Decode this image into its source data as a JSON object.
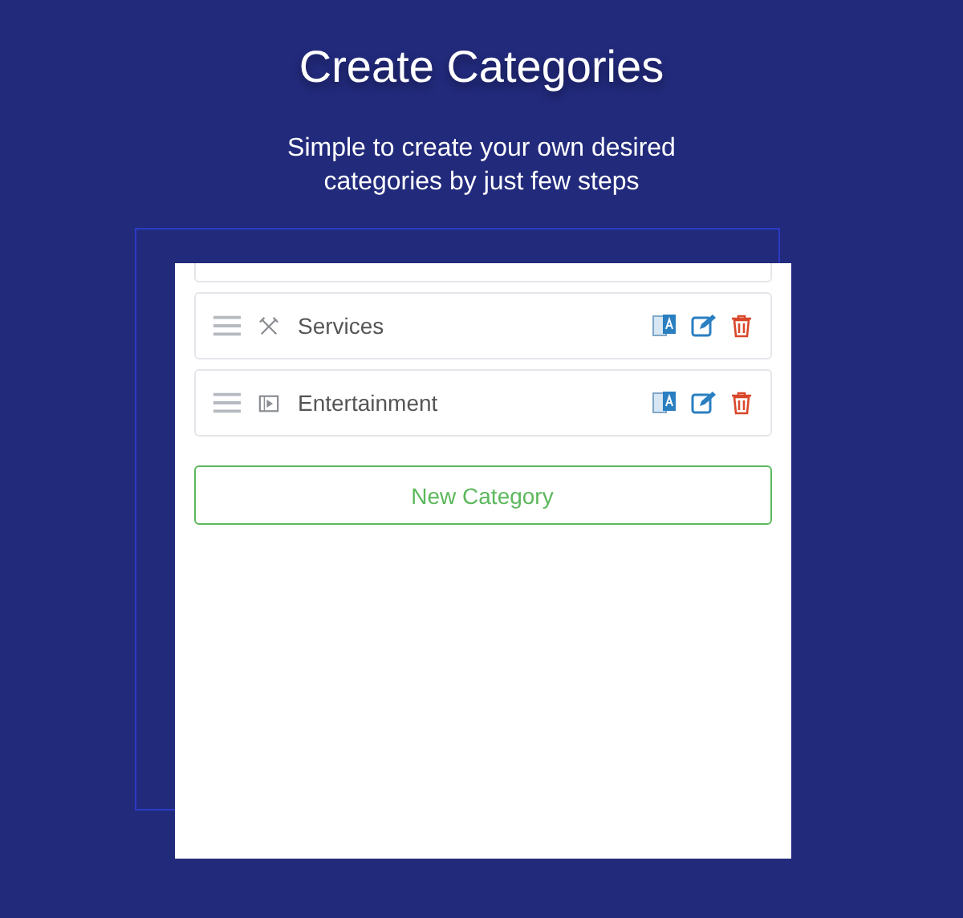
{
  "title": "Create Categories",
  "subtitle_lines": [
    "Simple to create your own desired",
    "categories by just few steps"
  ],
  "categories": [
    {
      "name": "Services"
    },
    {
      "name": "Entertainment"
    }
  ],
  "new_button": "New Category"
}
